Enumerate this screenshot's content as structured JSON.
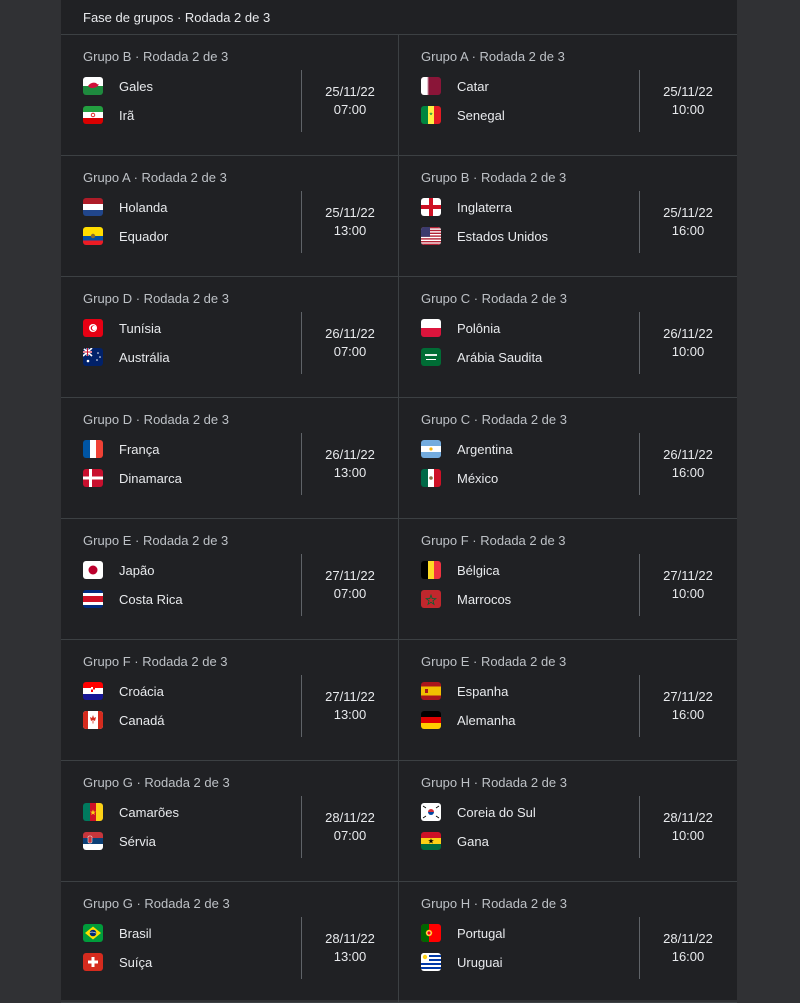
{
  "header": {
    "title": "Fase de grupos · Rodada 2 de 3"
  },
  "matches": [
    {
      "group": "Grupo B · Rodada 2 de 3",
      "team1": {
        "name": "Gales",
        "flag": "wales-flag-icon"
      },
      "team2": {
        "name": "Irã",
        "flag": "iran-flag-icon"
      },
      "date": "25/11/22",
      "time": "07:00"
    },
    {
      "group": "Grupo A · Rodada 2 de 3",
      "team1": {
        "name": "Catar",
        "flag": "qatar-flag-icon"
      },
      "team2": {
        "name": "Senegal",
        "flag": "senegal-flag-icon"
      },
      "date": "25/11/22",
      "time": "10:00"
    },
    {
      "group": "Grupo A · Rodada 2 de 3",
      "team1": {
        "name": "Holanda",
        "flag": "netherlands-flag-icon"
      },
      "team2": {
        "name": "Equador",
        "flag": "ecuador-flag-icon"
      },
      "date": "25/11/22",
      "time": "13:00"
    },
    {
      "group": "Grupo B · Rodada 2 de 3",
      "team1": {
        "name": "Inglaterra",
        "flag": "england-flag-icon"
      },
      "team2": {
        "name": "Estados Unidos",
        "flag": "usa-flag-icon"
      },
      "date": "25/11/22",
      "time": "16:00"
    },
    {
      "group": "Grupo D · Rodada 2 de 3",
      "team1": {
        "name": "Tunísia",
        "flag": "tunisia-flag-icon"
      },
      "team2": {
        "name": "Austrália",
        "flag": "australia-flag-icon"
      },
      "date": "26/11/22",
      "time": "07:00"
    },
    {
      "group": "Grupo C · Rodada 2 de 3",
      "team1": {
        "name": "Polônia",
        "flag": "poland-flag-icon"
      },
      "team2": {
        "name": "Arábia Saudita",
        "flag": "saudi-arabia-flag-icon"
      },
      "date": "26/11/22",
      "time": "10:00"
    },
    {
      "group": "Grupo D · Rodada 2 de 3",
      "team1": {
        "name": "França",
        "flag": "france-flag-icon"
      },
      "team2": {
        "name": "Dinamarca",
        "flag": "denmark-flag-icon"
      },
      "date": "26/11/22",
      "time": "13:00"
    },
    {
      "group": "Grupo C · Rodada 2 de 3",
      "team1": {
        "name": "Argentina",
        "flag": "argentina-flag-icon"
      },
      "team2": {
        "name": "México",
        "flag": "mexico-flag-icon"
      },
      "date": "26/11/22",
      "time": "16:00"
    },
    {
      "group": "Grupo E · Rodada 2 de 3",
      "team1": {
        "name": "Japão",
        "flag": "japan-flag-icon"
      },
      "team2": {
        "name": "Costa Rica",
        "flag": "costa-rica-flag-icon"
      },
      "date": "27/11/22",
      "time": "07:00"
    },
    {
      "group": "Grupo F · Rodada 2 de 3",
      "team1": {
        "name": "Bélgica",
        "flag": "belgium-flag-icon"
      },
      "team2": {
        "name": "Marrocos",
        "flag": "morocco-flag-icon"
      },
      "date": "27/11/22",
      "time": "10:00"
    },
    {
      "group": "Grupo F · Rodada 2 de 3",
      "team1": {
        "name": "Croácia",
        "flag": "croatia-flag-icon"
      },
      "team2": {
        "name": "Canadá",
        "flag": "canada-flag-icon"
      },
      "date": "27/11/22",
      "time": "13:00"
    },
    {
      "group": "Grupo E · Rodada 2 de 3",
      "team1": {
        "name": "Espanha",
        "flag": "spain-flag-icon"
      },
      "team2": {
        "name": "Alemanha",
        "flag": "germany-flag-icon"
      },
      "date": "27/11/22",
      "time": "16:00"
    },
    {
      "group": "Grupo G · Rodada 2 de 3",
      "team1": {
        "name": "Camarões",
        "flag": "cameroon-flag-icon"
      },
      "team2": {
        "name": "Sérvia",
        "flag": "serbia-flag-icon"
      },
      "date": "28/11/22",
      "time": "07:00"
    },
    {
      "group": "Grupo H · Rodada 2 de 3",
      "team1": {
        "name": "Coreia do Sul",
        "flag": "south-korea-flag-icon"
      },
      "team2": {
        "name": "Gana",
        "flag": "ghana-flag-icon"
      },
      "date": "28/11/22",
      "time": "10:00"
    },
    {
      "group": "Grupo G · Rodada 2 de 3",
      "team1": {
        "name": "Brasil",
        "flag": "brazil-flag-icon"
      },
      "team2": {
        "name": "Suíça",
        "flag": "switzerland-flag-icon"
      },
      "date": "28/11/22",
      "time": "13:00"
    },
    {
      "group": "Grupo H · Rodada 2 de 3",
      "team1": {
        "name": "Portugal",
        "flag": "portugal-flag-icon"
      },
      "team2": {
        "name": "Uruguai",
        "flag": "uruguay-flag-icon"
      },
      "date": "28/11/22",
      "time": "16:00"
    }
  ]
}
